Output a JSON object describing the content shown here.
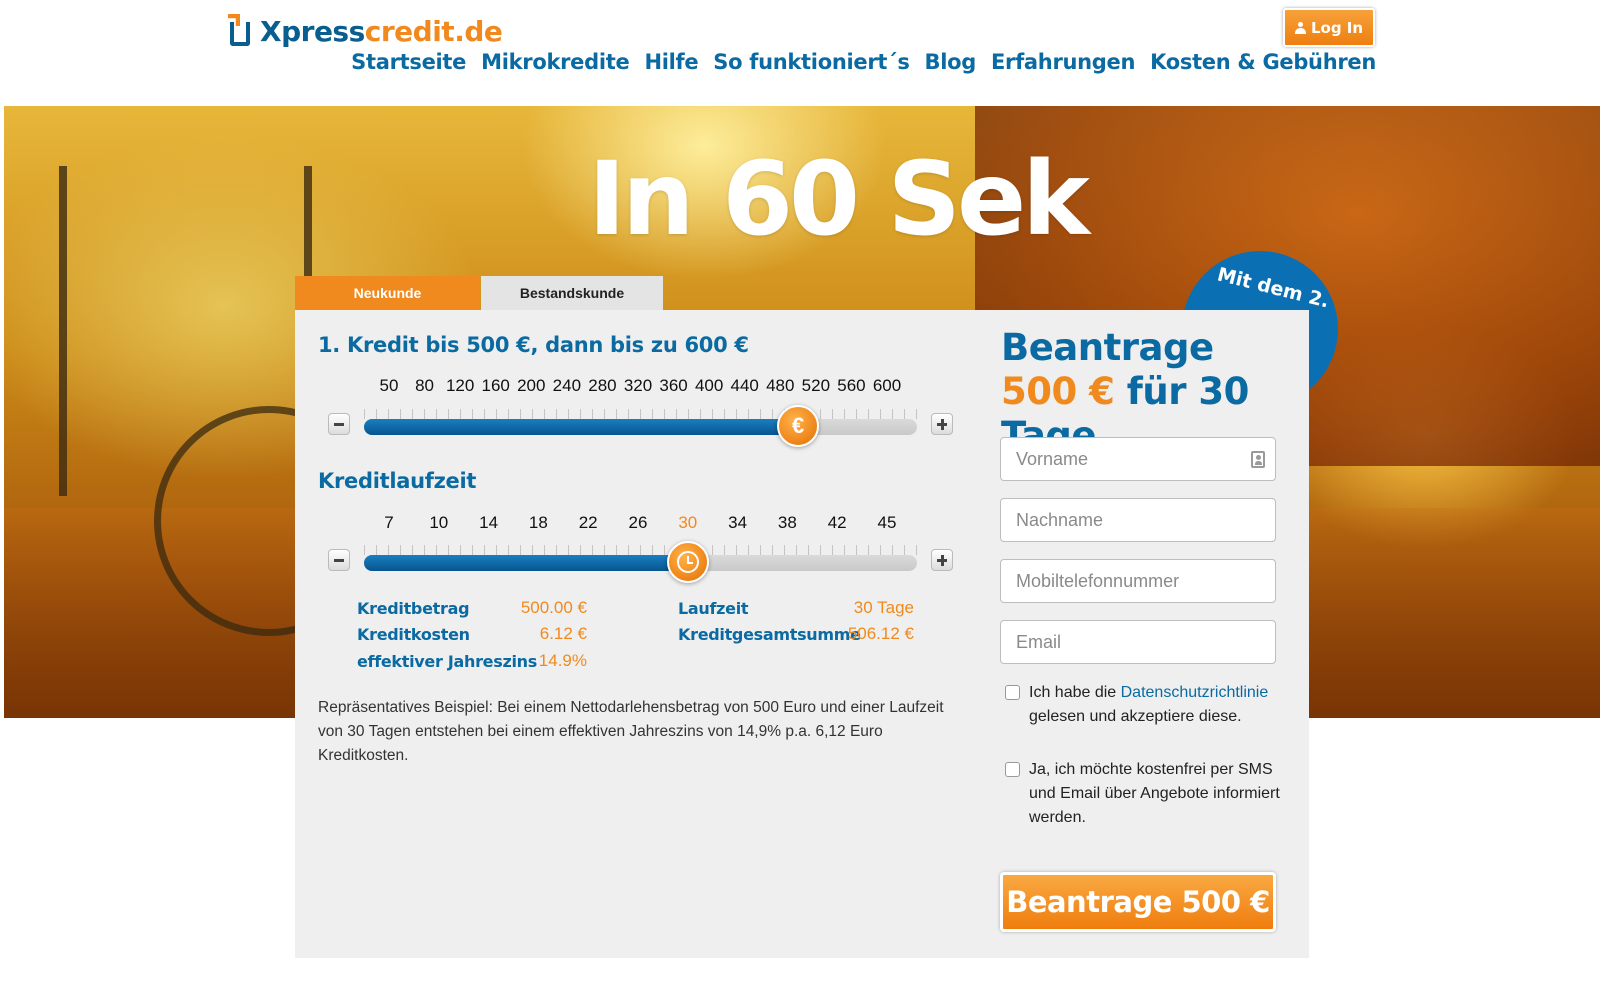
{
  "brand": {
    "name_part1": "Xpress",
    "name_part2": "credit.de"
  },
  "header": {
    "login_label": "Log In",
    "nav": [
      "Startseite",
      "Mikrokredite",
      "Hilfe",
      "So funktioniert´s",
      "Blog",
      "Erfahrungen",
      "Kosten & Gebühren"
    ]
  },
  "hero": {
    "headline": "In 60 Sek",
    "promo_text": "Mit dem 2."
  },
  "tabs": {
    "new_customer": "Neukunde",
    "existing_customer": "Bestandskunde"
  },
  "calculator": {
    "amount": {
      "title": "1. Kredit bis 500 €, dann bis zu 600 €",
      "ticks": [
        "50",
        "80",
        "120",
        "160",
        "200",
        "240",
        "280",
        "320",
        "360",
        "400",
        "440",
        "480",
        "520",
        "560",
        "600"
      ],
      "min": 50,
      "max": 600,
      "value": 500,
      "knob_icon": "€"
    },
    "duration": {
      "title": "Kreditlaufzeit",
      "ticks": [
        "7",
        "10",
        "14",
        "18",
        "22",
        "26",
        "30",
        "34",
        "38",
        "42",
        "45"
      ],
      "min": 7,
      "max": 45,
      "value": 30,
      "knob_icon": "clock-icon"
    },
    "summary": {
      "kreditbetrag_label": "Kreditbetrag",
      "kreditbetrag_value": "500.00 €",
      "kreditkosten_label": "Kreditkosten",
      "kreditkosten_value": "6.12 €",
      "jahreszins_label": "effektiver Jahreszins",
      "jahreszins_value": "14.9%",
      "laufzeit_label": "Laufzeit",
      "laufzeit_value": "30 Tage",
      "gesamtsumme_label": "Kreditgesamtsumme",
      "gesamtsumme_value": "506.12 €"
    },
    "example_text": "Repräsentatives Beispiel: Bei einem Nettodarlehensbetrag von 500 Euro und einer Laufzeit von 30 Tagen entstehen bei einem effektiven Jahreszins von 14,9% p.a. 6,12 Euro Kreditkosten."
  },
  "form": {
    "title_part1": "Beantrage ",
    "title_amount": "500 €",
    "title_part2": " für 30 Tage",
    "fields": {
      "vorname": "Vorname",
      "nachname": "Nachname",
      "mobil": "Mobiltelefonnummer",
      "email": "Email"
    },
    "privacy_pre": "Ich habe die ",
    "privacy_link": "Datenschutzrichtlinie",
    "privacy_post": " gelesen und akzeptiere diese.",
    "newsletter": "Ja, ich möchte kostenfrei per SMS und Email über Angebote informiert werden.",
    "submit_label": "Beantrage 500 €"
  },
  "colors": {
    "brand_blue": "#0a6aa1",
    "brand_orange": "#f08a1e"
  }
}
